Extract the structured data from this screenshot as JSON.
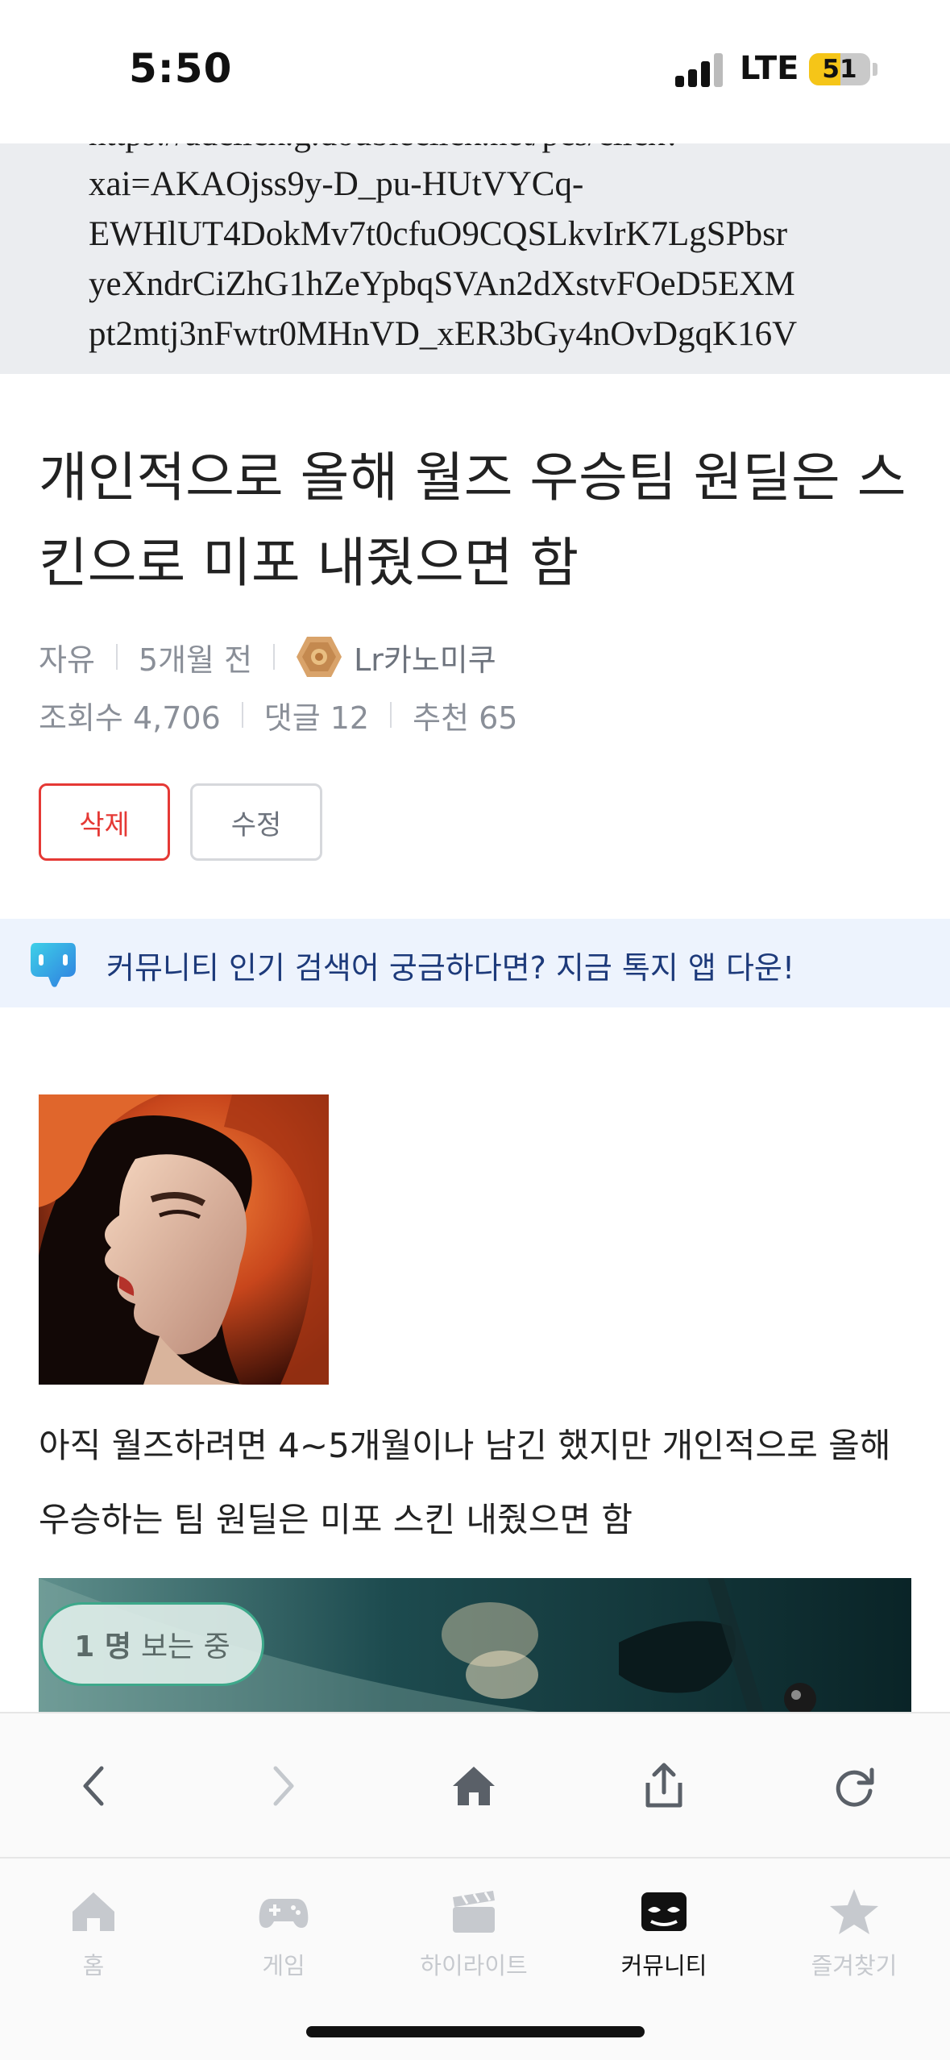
{
  "status_bar": {
    "time": "5:50",
    "network": "LTE",
    "battery": "51"
  },
  "ad_url_lines": [
    "https://adclick.g.doubleclick.net/pcs/click?",
    "xai=AKAOjss9y-D_pu-HUtVYCq-",
    "EWHlUT4DokMv7t0cfuO9CQSLkvIrK7LgSPbsr",
    "yeXndrCiZhG1hZeYpbqSVAn2dXstvFOeD5EXM",
    "pt2mtj3nFwtr0MHnVD_xER3bGy4nOvDgqK16V"
  ],
  "post": {
    "title": "개인적으로 올해 월즈 우승팀 원딜은 스킨으로 미포 내줬으면 함",
    "category": "자유",
    "time_ago": "5개월 전",
    "author": "Lr카노미쿠",
    "views": "조회수 4,706",
    "comments": "댓글 12",
    "likes": "추천 65",
    "body": "아직 월즈하려면 4~5개월이나 남긴 했지만 개인적으로 올해 우승하는 팀 원딜은 미포 스킨 내줬으면 함"
  },
  "buttons": {
    "delete": "삭제",
    "edit": "수정"
  },
  "promo": {
    "text": "커뮤니티 인기 검색어 궁금하다면? 지금 톡지 앱 다운!"
  },
  "viewer_pill": {
    "count": "1 명",
    "suffix": "보는 중"
  },
  "browser_toolbar": {
    "icons": [
      "back-icon",
      "forward-icon",
      "home-icon",
      "share-icon",
      "reload-icon"
    ]
  },
  "tabs": [
    {
      "label": "홈",
      "icon": "home-icon"
    },
    {
      "label": "게임",
      "icon": "gamepad-icon"
    },
    {
      "label": "하이라이트",
      "icon": "clapperboard-icon"
    },
    {
      "label": "커뮤니티",
      "icon": "community-mask-icon",
      "active": true
    },
    {
      "label": "즐겨찾기",
      "icon": "star-icon"
    }
  ],
  "colors": {
    "delete_red": "#e53935",
    "promo_bg": "#edf3fd",
    "promo_text": "#1d3a7a",
    "battery_yellow": "#f5c518",
    "viewer_border": "#3da88a"
  }
}
